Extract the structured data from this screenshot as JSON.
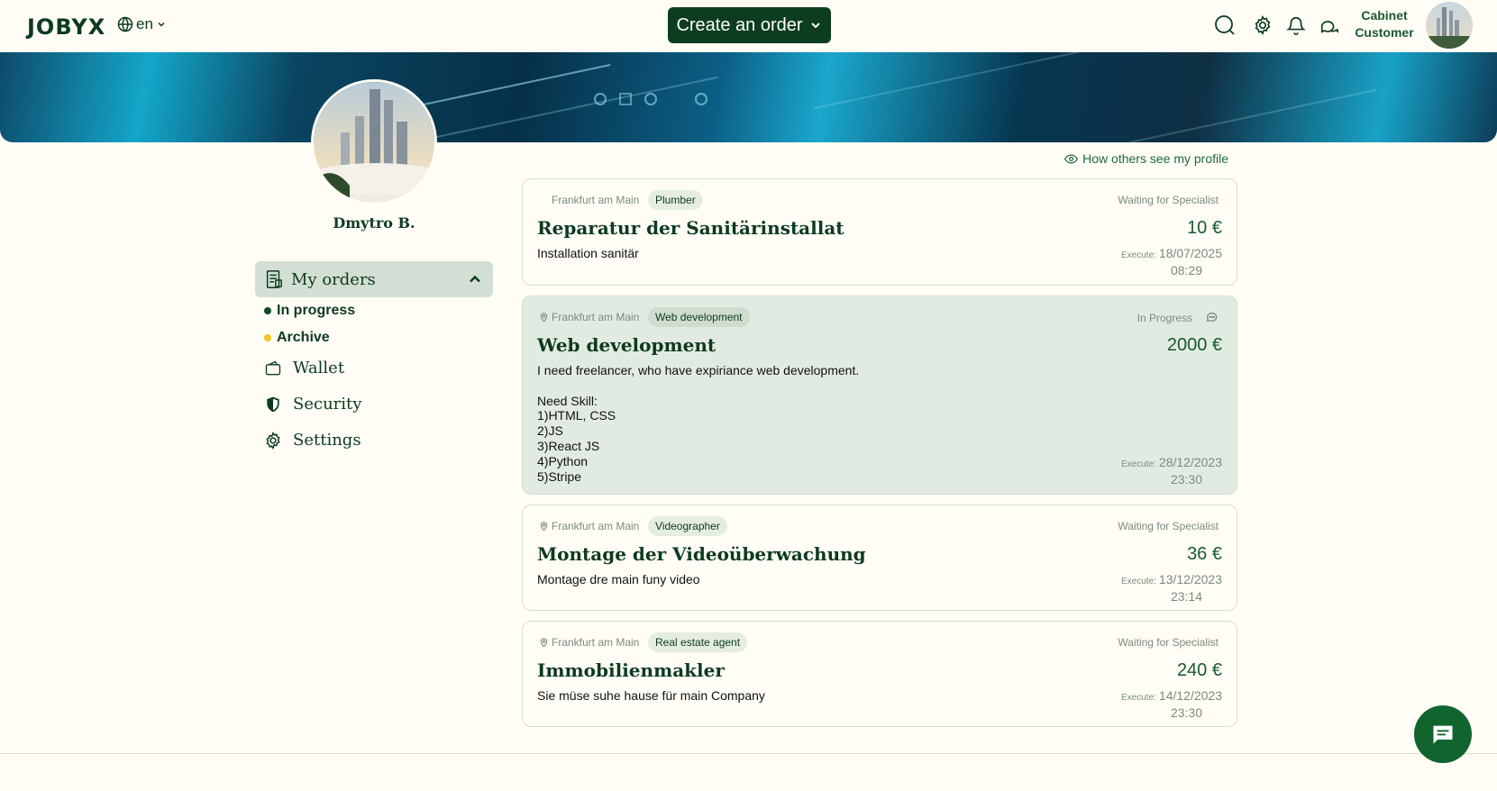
{
  "header": {
    "logo": "JOBYX",
    "language": "en",
    "create_order_label": "Create an order",
    "cabinet_line1": "Cabinet",
    "cabinet_line2": "Customer"
  },
  "profile": {
    "name": "Dmytro B.",
    "view_link": "How others see my profile"
  },
  "sidebar": {
    "my_orders": "My orders",
    "sub_items": [
      {
        "label": "In progress",
        "color": "#0d4a22"
      },
      {
        "label": "Archive",
        "color": "#f3c623"
      }
    ],
    "items": [
      {
        "label": "Wallet"
      },
      {
        "label": "Security"
      },
      {
        "label": "Settings"
      }
    ]
  },
  "orders": [
    {
      "location": "Frankfurt am Main",
      "tag": "Plumber",
      "status": "Waiting for Specialist",
      "title": "Reparatur der Sanitärinstallat",
      "price": "10 €",
      "description": "Installation sanitär",
      "execute_label": "Execute:",
      "execute_date": "18/07/2025",
      "execute_time": "08:29"
    },
    {
      "location": "Frankfurt am Main",
      "tag": "Web development",
      "status": "In Progress",
      "title": "Web development",
      "price": "2000 €",
      "description": "I need freelancer, who have expiriance web development.\n\nNeed Skill:\n1)HTML, CSS\n2)JS\n3)React JS\n4)Python\n5)Stripe",
      "execute_label": "Execute:",
      "execute_date": "28/12/2023",
      "execute_time": "23:30"
    },
    {
      "location": "Frankfurt am Main",
      "tag": "Videographer",
      "status": "Waiting for Specialist",
      "title": "Montage der Videoüberwachung",
      "price": "36 €",
      "description": "Montage dre main funy video",
      "execute_label": "Execute:",
      "execute_date": "13/12/2023",
      "execute_time": "23:14"
    },
    {
      "location": "Frankfurt am Main",
      "tag": "Real estate agent",
      "status": "Waiting for Specialist",
      "title": "Immobilienmakler",
      "price": "240 €",
      "description": "Sie müse suhe hause für main Company",
      "execute_label": "Execute:",
      "execute_date": "14/12/2023",
      "execute_time": "23:30"
    }
  ],
  "colors": {
    "brand_dark": "#0c3d1f",
    "accent_green": "#1a5a30",
    "active_card": "#e2ebe2"
  }
}
